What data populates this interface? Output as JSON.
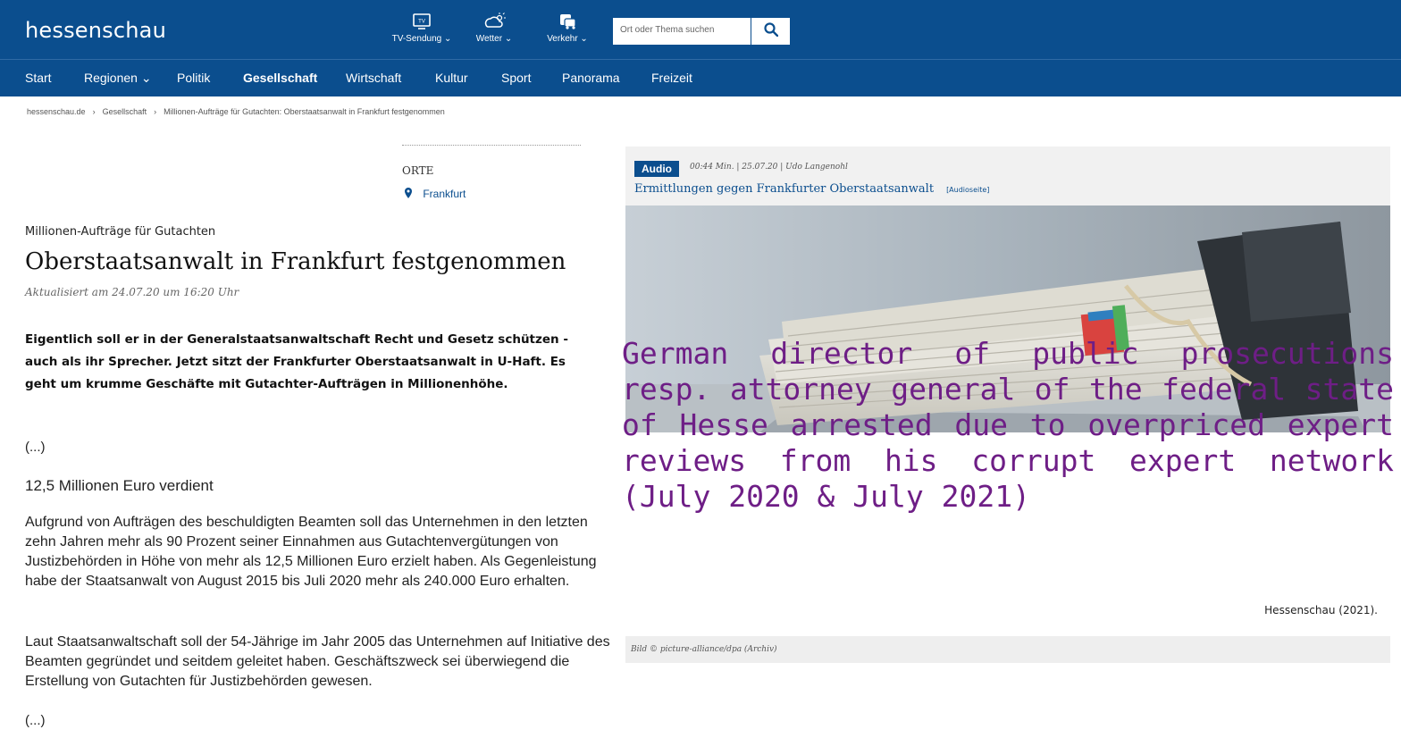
{
  "header": {
    "logo": "hessenschau",
    "tools": [
      {
        "label": "TV-Sendung ⌄",
        "icon": "tv-icon"
      },
      {
        "label": "Wetter ⌄",
        "icon": "weather-icon"
      },
      {
        "label": "Verkehr ⌄",
        "icon": "traffic-icon"
      }
    ],
    "search_placeholder": "Ort oder Thema suchen"
  },
  "nav": {
    "items": [
      "Start",
      "Regionen ⌄",
      "Politik",
      "Gesellschaft",
      "Wirtschaft",
      "Kultur",
      "Sport",
      "Panorama",
      "Freizeit"
    ],
    "active": "Gesellschaft"
  },
  "breadcrumb": {
    "items": [
      "hessenschau.de",
      "Gesellschaft",
      "Millionen-Aufträge für Gutachten: Oberstaatsanwalt in Frankfurt festgenommen"
    ],
    "separator": "›"
  },
  "places": {
    "label": "ORTE",
    "place": "Frankfurt"
  },
  "article": {
    "kicker": "Millionen-Aufträge für Gutachten",
    "headline": "Oberstaatsanwalt in Frankfurt festgenommen",
    "updated": "Aktualisiert am 24.07.20 um 16:20 Uhr",
    "lead": "Eigentlich soll er in der Generalstaatsanwaltschaft Recht und Gesetz schützen - auch als ihr Sprecher. Jetzt sitzt der Frankfurter Oberstaatsanwalt in U-Haft. Es geht um krumme Geschäfte mit Gutachter-Aufträgen in Millionenhöhe.",
    "ellipsis": "(...)",
    "subhead": "12,5 Millionen Euro verdient",
    "para1": "Aufgrund von Aufträgen des beschuldigten Beamten soll das Unternehmen in den letzten zehn Jahren mehr als 90 Prozent seiner Einnahmen aus Gutachtenvergütungen von Justizbehörden in Höhe von mehr als 12,5 Millionen Euro erzielt haben. Als Gegenleistung habe der Staatsanwalt von August 2015 bis Juli 2020 mehr als 240.000 Euro erhalten.",
    "para2": "Laut Staatsanwaltschaft soll der 54-Jährige im Jahr 2005 das Unternehmen auf Initiative des Beamten gegründet und seitdem geleitet haben. Geschäftszweck sei überwiegend die Erstellung von Gutachten für Justizbehörden gewesen.",
    "ellipsis2": "(...)"
  },
  "audio": {
    "badge": "Audio",
    "meta": "00:44 Min.  | 25.07.20  | Udo Langenohl",
    "title": "Ermittlungen gegen Frankfurter Oberstaatsanwalt",
    "link": "[Audioseite]"
  },
  "image_caption": "Bild © picture-alliance/dpa (Archiv)",
  "overlay_text": "German director of public prosecutions resp. attorney general of the federal state of Hesse arrested due to overpriced expert reviews from his corrupt expert network (July 2020 & July 2021)",
  "source": "Hessenschau (2021).",
  "colors": {
    "brand_blue": "#0b4e8e",
    "overlay_purple": "#6e1e86"
  }
}
